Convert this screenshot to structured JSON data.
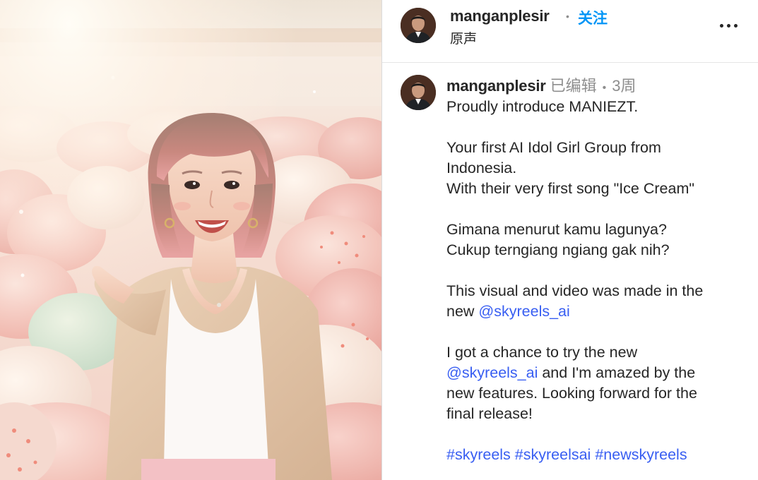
{
  "header": {
    "username": "manganplesir",
    "dot": "•",
    "follow_label": "关注",
    "audio_label": "原声",
    "more_icon": "more-horizontal-icon"
  },
  "caption": {
    "username": "manganplesir",
    "edited_label": "已编辑",
    "dot": "•",
    "timestamp": "3周",
    "lines": {
      "l1": "Proudly introduce MANIEZT.",
      "l2": "Your first AI Idol Girl Group from",
      "l3": "Indonesia.",
      "l4": "With their very first song \"Ice Cream\"",
      "l5": "Gimana menurut kamu lagunya?",
      "l6": "Cukup terngiang ngiang gak nih?",
      "l7": "This visual and video was made in the",
      "l8_prefix": "new ",
      "l8_mention": "@skyreels_ai",
      "l9": "I got a chance to try the new",
      "l10_mention": "@skyreels_ai",
      "l10_suffix": " and I'm amazed by the",
      "l11": "new features. Looking forward for the",
      "l12": "final release!"
    },
    "hashtags": [
      "#skyreels",
      "#skyreelsai",
      "#newskyreels"
    ]
  },
  "colors": {
    "link": "#385ef2",
    "follow": "#0095f6",
    "text": "#262626",
    "muted": "#8e8e8e"
  }
}
